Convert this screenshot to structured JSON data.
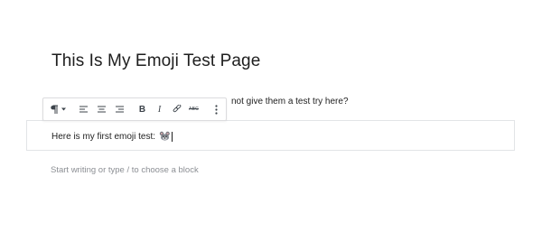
{
  "post": {
    "title": "This Is My Emoji Test Page"
  },
  "blocks": {
    "previous_paragraph_visible": "not give them a test try here?",
    "current_paragraph_text": "Here is my first emoji test:",
    "current_paragraph_emoji": "mouse-emoji",
    "placeholder": "Start writing or type / to choose a block"
  },
  "toolbar": {
    "block_type_icon": "paragraph-icon",
    "alignment_icons": [
      "align-left-icon",
      "align-center-icon",
      "align-right-icon"
    ],
    "format_icons": [
      "bold-icon",
      "italic-icon",
      "link-icon",
      "strikethrough-icon"
    ],
    "bold_label": "B",
    "italic_label": "I",
    "strikethrough_label": "ABC",
    "more_icon": "more-vertical-icon"
  }
}
